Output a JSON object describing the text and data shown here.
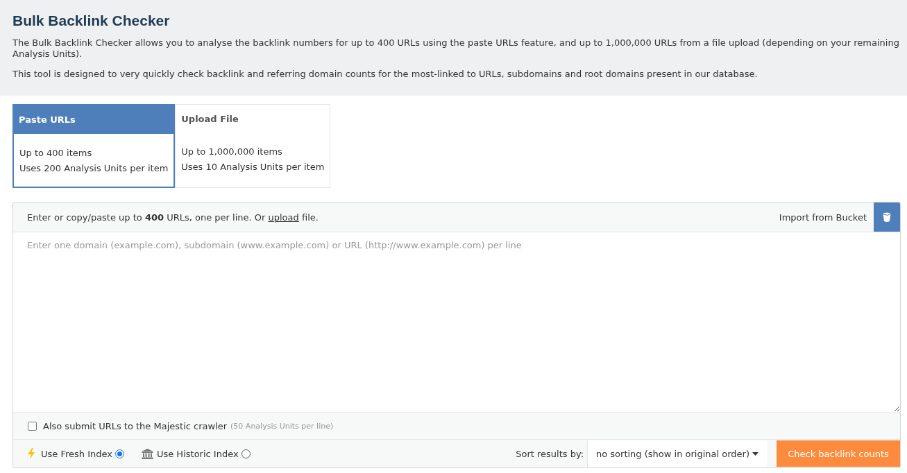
{
  "header": {
    "title": "Bulk Backlink Checker",
    "paragraphs": [
      "The Bulk Backlink Checker allows you to analyse the backlink numbers for up to 400 URLs using the paste URLs feature, and up to 1,000,000 URLs from a file upload (depending on your remaining Analysis Units).",
      "This tool is designed to very quickly check backlink and referring domain counts for the most-linked to URLs, subdomains and root domains present in our database."
    ]
  },
  "tabs": [
    {
      "title": "Paste URLs",
      "lines": [
        "Up to 400 items",
        "Uses 200 Analysis Units per item"
      ],
      "selected": true
    },
    {
      "title": "Upload File",
      "lines": [
        "Up to 1,000,000 items",
        "Uses 10 Analysis Units per item"
      ],
      "selected": false
    }
  ],
  "url_panel": {
    "instruction": {
      "text_before": "Enter or copy/paste up to **400** URLs, one per line. Or",
      "link": "upload",
      "text_after": "file."
    },
    "import_button": {
      "label": "Import from Bucket"
    },
    "url_input": {
      "placeholder": "Enter one domain (example.com), subdomain (www.example.com) or URL (http://www.example.com) per line"
    },
    "crawler_option": {
      "label": "Also submit URLs to the Majestic crawler",
      "note": "(50 Analysis Units per line)",
      "checked": false
    },
    "index_options": [
      {
        "kind": "fresh",
        "label": "Use Fresh Index",
        "selected": true
      },
      {
        "kind": "historic",
        "label": "Use Historic Index",
        "selected": false
      }
    ],
    "sort": {
      "label": "Sort results by:",
      "value": "no sorting (show in original order)"
    },
    "submit_button": {
      "label": "Check backlink counts"
    }
  }
}
